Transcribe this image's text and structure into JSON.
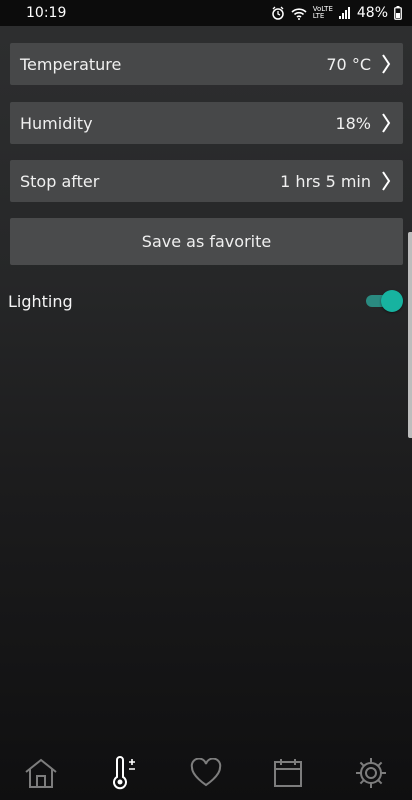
{
  "status_bar": {
    "time": "10:19",
    "battery_percent": "48%",
    "icons": [
      "alarm-icon",
      "wifi-icon",
      "volte-icon",
      "signal-icon",
      "battery-icon"
    ],
    "volte_label": "VoLTE",
    "lte_label": "LTE"
  },
  "settings": {
    "temperature": {
      "label": "Temperature",
      "value": "70 °C"
    },
    "humidity": {
      "label": "Humidity",
      "value": "18%"
    },
    "stop_after": {
      "label": "Stop after",
      "value": "1 hrs 5 min"
    }
  },
  "save_button_label": "Save as favorite",
  "lighting": {
    "label": "Lighting",
    "enabled": true
  },
  "bottom_nav": {
    "items": [
      "home-icon",
      "thermometer-icon",
      "heart-icon",
      "calendar-icon",
      "gear-icon"
    ],
    "active_index": 1
  },
  "colors": {
    "accent": "#17b3a0",
    "panel": "#474849",
    "background": "#262728"
  }
}
